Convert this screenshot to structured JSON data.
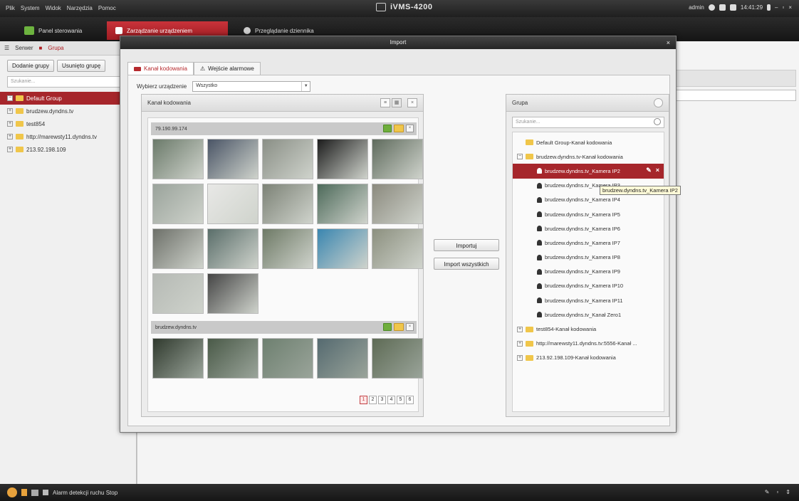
{
  "menubar": {
    "menus": [
      "Plik",
      "System",
      "Widok",
      "Narzędzia",
      "Pomoc"
    ],
    "app_title": "iVMS-4200",
    "user": "admin",
    "clock": "14:41:29"
  },
  "tabs": [
    {
      "label": "Panel sterowania",
      "active": false
    },
    {
      "label": "Zarządzanie urządzeniem",
      "active": true
    },
    {
      "label": "Przeglądanie dziennika",
      "active": false
    }
  ],
  "left_panel": {
    "header_server": "Serwer",
    "header_group": "Grupa",
    "add_group_button": "Dodanie grupy",
    "delete_group_button": "Usunięto grupę",
    "search_placeholder": "Szukanie...",
    "tree": [
      {
        "label": "Default Group",
        "selected": true
      },
      {
        "label": "brudzew.dyndns.tv",
        "selected": false
      },
      {
        "label": "test854",
        "selected": false
      },
      {
        "label": "http://marewsty11.dyndns.tv",
        "selected": false
      },
      {
        "label": "213.92.198.109",
        "selected": false
      }
    ]
  },
  "status_bar": {
    "text": "Alarm detekcji ruchu Stop"
  },
  "dialog": {
    "title": "Import",
    "tabs": [
      {
        "label": "Kanał kodowania",
        "active": true
      },
      {
        "label": "Wejście alarmowe",
        "active": false
      }
    ],
    "device_select_label": "Wybierz urządzenie",
    "device_select_value": "Wszystko",
    "channel_panel": {
      "title": "Kanał kodowania",
      "devices": [
        {
          "name": "79.190.99.174",
          "thumb_count": 17
        },
        {
          "name": "brudzew.dyndns.tv",
          "thumb_count": 5
        }
      ],
      "pages": [
        "1",
        "2",
        "3",
        "4",
        "5",
        "6"
      ],
      "active_page": "1"
    },
    "import_button": "Importuj",
    "import_all_button": "Import wszystkich",
    "group_panel": {
      "title": "Grupa",
      "search_placeholder": "Szukanie...",
      "tree": [
        {
          "label": "Default Group-Kanał kodowania",
          "type": "folder",
          "level": 0,
          "expander": false,
          "selected": false
        },
        {
          "label": "brudzew.dyndns.tv-Kanał kodowania",
          "type": "folder",
          "level": 0,
          "expander": true,
          "selected": false
        },
        {
          "label": "brudzew.dyndns.tv_Kamera IP2",
          "type": "camera",
          "level": 1,
          "selected": true
        },
        {
          "label": "brudzew.dyndns.tv_Kamera IP3",
          "type": "camera",
          "level": 1,
          "selected": false
        },
        {
          "label": "brudzew.dyndns.tv_Kamera IP4",
          "type": "camera",
          "level": 1,
          "selected": false
        },
        {
          "label": "brudzew.dyndns.tv_Kamera IP5",
          "type": "camera",
          "level": 1,
          "selected": false
        },
        {
          "label": "brudzew.dyndns.tv_Kamera IP6",
          "type": "camera",
          "level": 1,
          "selected": false
        },
        {
          "label": "brudzew.dyndns.tv_Kamera IP7",
          "type": "camera",
          "level": 1,
          "selected": false
        },
        {
          "label": "brudzew.dyndns.tv_Kamera IP8",
          "type": "camera",
          "level": 1,
          "selected": false
        },
        {
          "label": "brudzew.dyndns.tv_Kamera IP9",
          "type": "camera",
          "level": 1,
          "selected": false
        },
        {
          "label": "brudzew.dyndns.tv_Kamera IP10",
          "type": "camera",
          "level": 1,
          "selected": false
        },
        {
          "label": "brudzew.dyndns.tv_Kamera IP11",
          "type": "camera",
          "level": 1,
          "selected": false
        },
        {
          "label": "brudzew.dyndns.tv_Kanał Zero1",
          "type": "camera",
          "level": 1,
          "selected": false
        },
        {
          "label": "test854-Kanał kodowania",
          "type": "folder",
          "level": 0,
          "expander": true,
          "selected": false
        },
        {
          "label": "http://marewsty11.dyndns.tv:5556-Kanał ...",
          "type": "folder",
          "level": 0,
          "expander": true,
          "selected": false
        },
        {
          "label": "213.92.198.109-Kanał kodowania",
          "type": "folder",
          "level": 0,
          "expander": true,
          "selected": false
        }
      ],
      "tooltip": "brudzew.dyndns.tv_Kamera IP2"
    }
  },
  "colors": {
    "accent": "#a6262b",
    "folder": "#f0c64a",
    "add_green": "#6fae3c"
  }
}
